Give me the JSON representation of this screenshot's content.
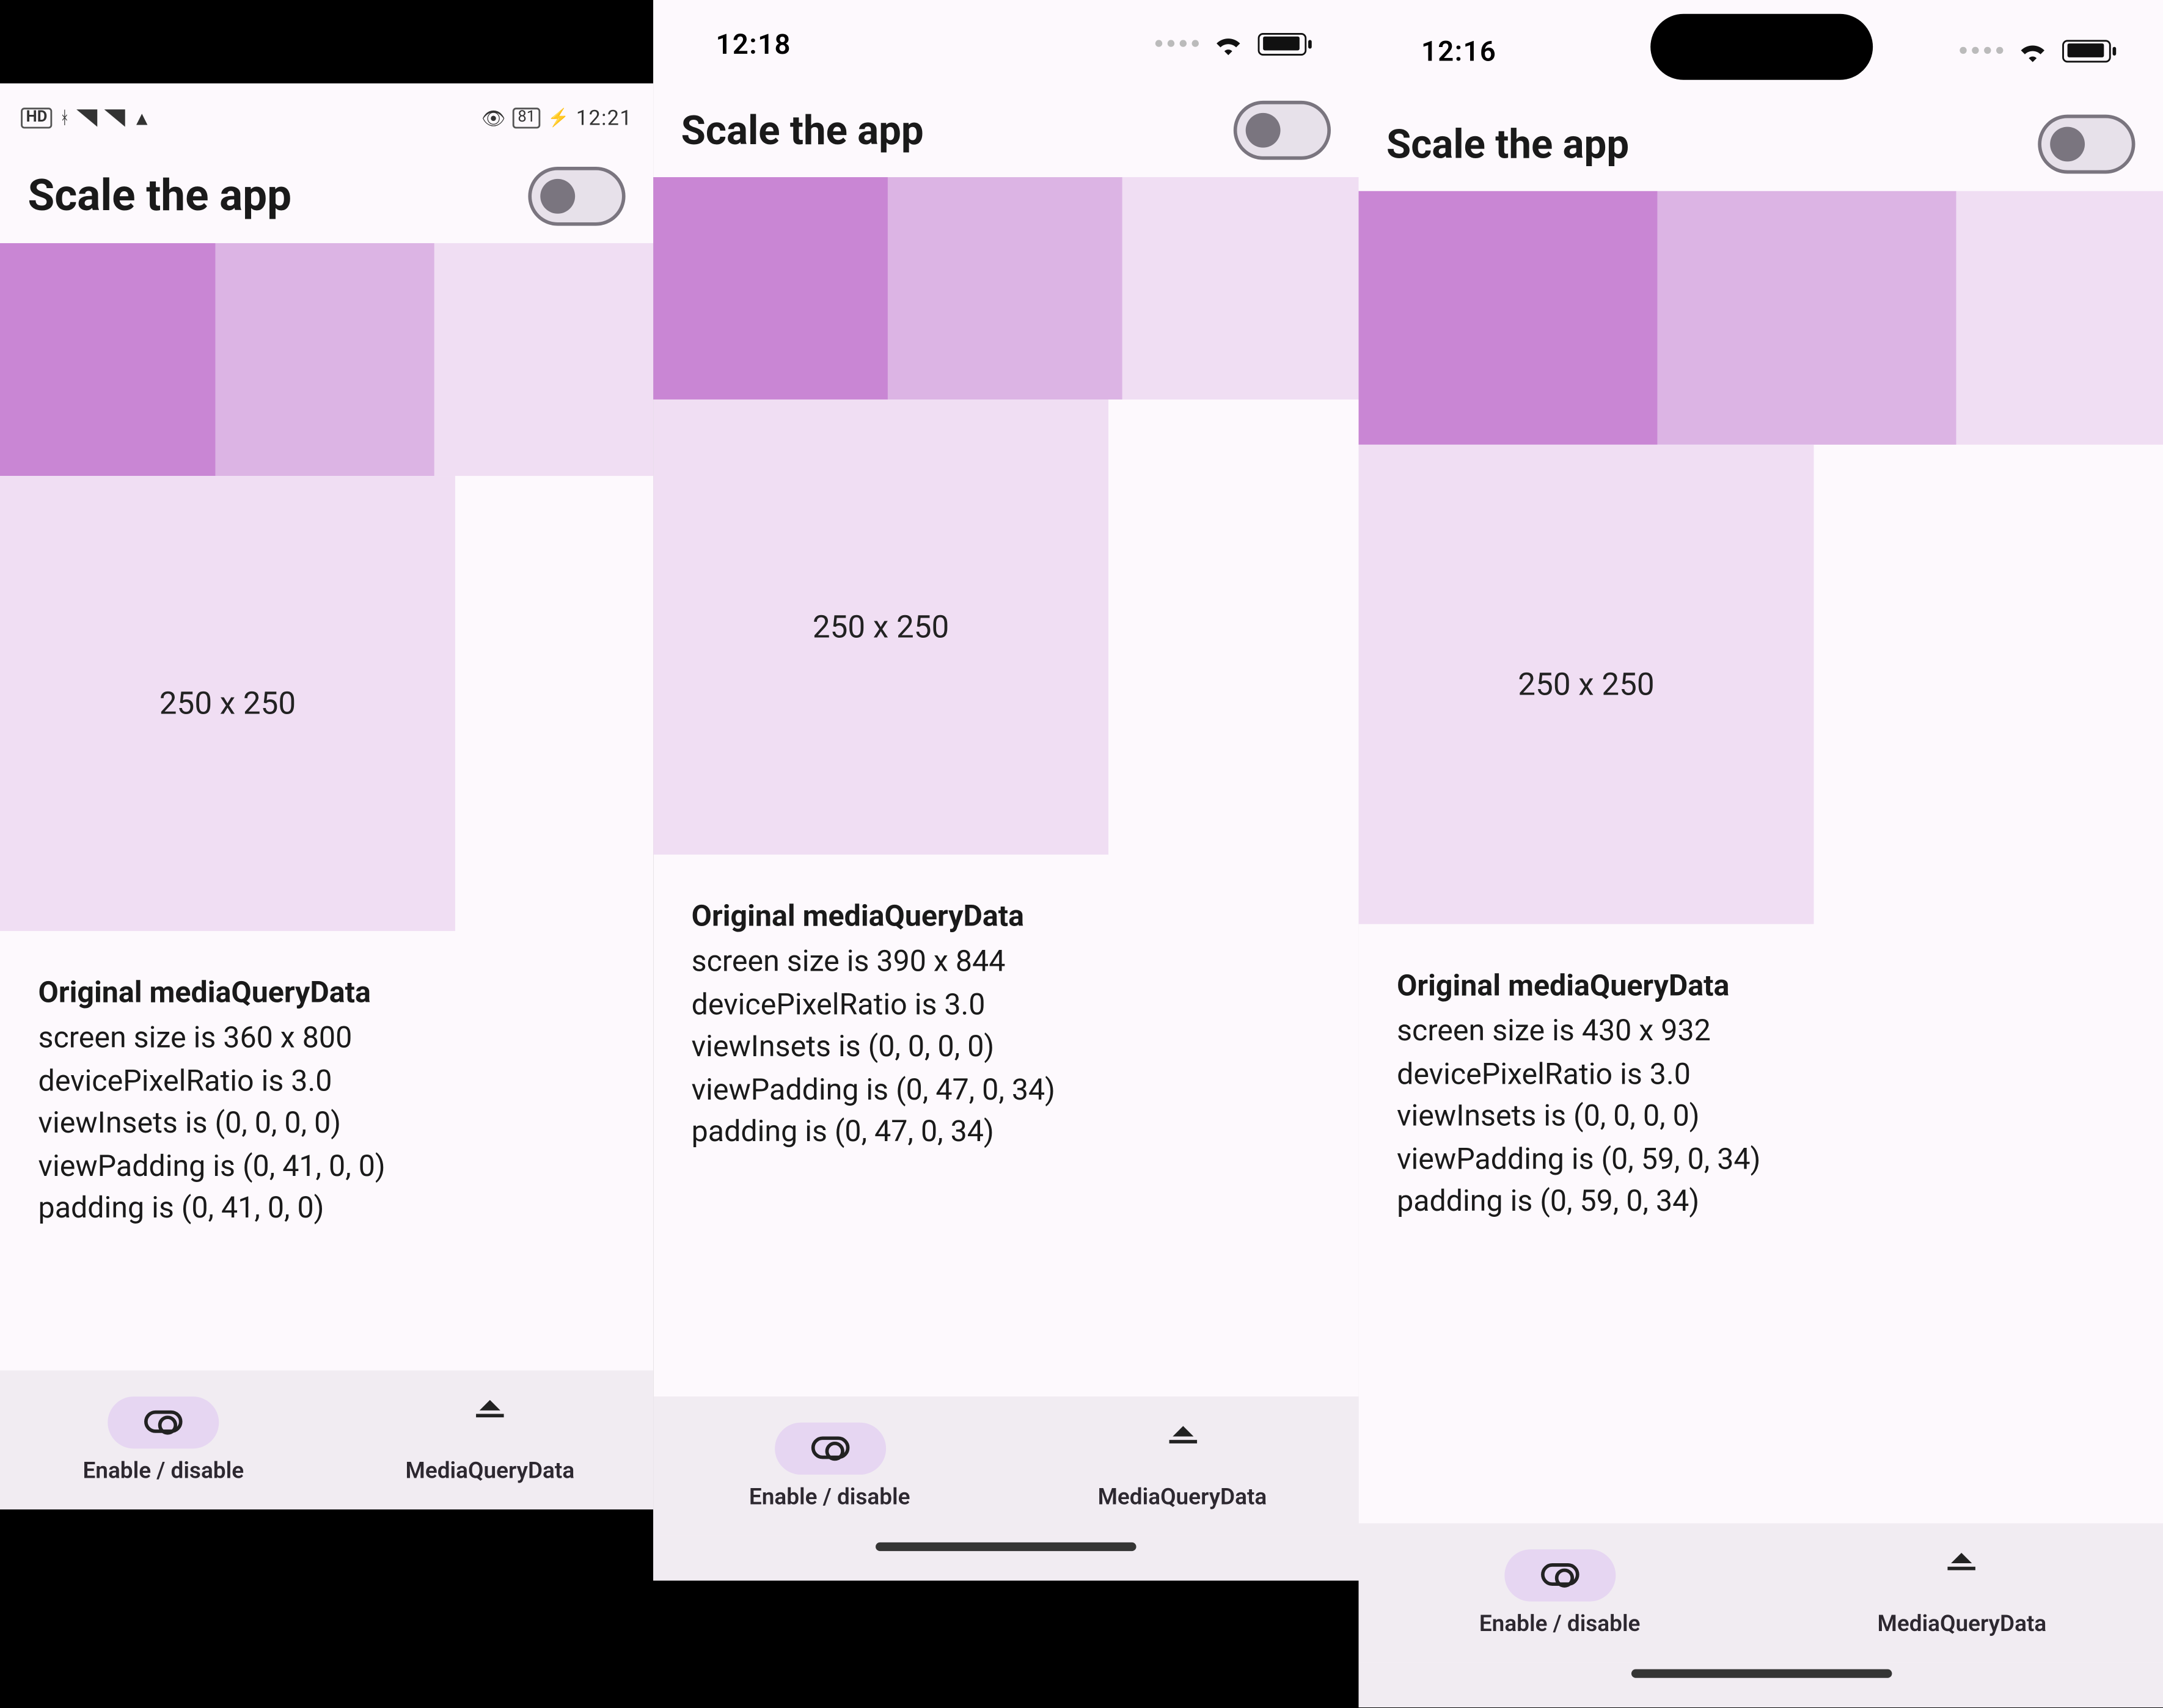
{
  "phones": [
    {
      "key": "p1",
      "status": {
        "kind": "android",
        "left_text": "HD",
        "batt": "81",
        "time": "12:21"
      },
      "title": "Scale the app",
      "box_label": "250 x 250",
      "info": {
        "heading": "Original mediaQueryData",
        "lines": [
          "screen size is 360 x 800",
          "devicePixelRatio is 3.0",
          "viewInsets is (0, 0, 0, 0)",
          "viewPadding is (0, 41, 0, 0)",
          "padding is (0, 41, 0, 0)"
        ]
      },
      "nav": {
        "a": "Enable / disable",
        "b": "MediaQueryData"
      }
    },
    {
      "key": "p2",
      "status": {
        "kind": "ios",
        "time": "12:18",
        "pill": false
      },
      "title": "Scale the app",
      "box_label": "250 x 250",
      "info": {
        "heading": "Original mediaQueryData",
        "lines": [
          "screen size is 390 x 844",
          "devicePixelRatio is 3.0",
          "viewInsets is (0, 0, 0, 0)",
          "viewPadding is (0, 47, 0, 34)",
          "padding is (0, 47, 0, 34)"
        ]
      },
      "nav": {
        "a": "Enable / disable",
        "b": "MediaQueryData"
      }
    },
    {
      "key": "p3",
      "status": {
        "kind": "ios",
        "time": "12:16",
        "pill": true
      },
      "title": "Scale the app",
      "box_label": "250 x 250",
      "info": {
        "heading": "Original mediaQueryData",
        "lines": [
          "screen size is 430 x 932",
          "devicePixelRatio is 3.0",
          "viewInsets is (0, 0, 0, 0)",
          "viewPadding is (0, 59, 0, 34)",
          "padding is (0, 59, 0, 34)"
        ]
      },
      "nav": {
        "a": "Enable / disable",
        "b": "MediaQueryData"
      }
    }
  ]
}
